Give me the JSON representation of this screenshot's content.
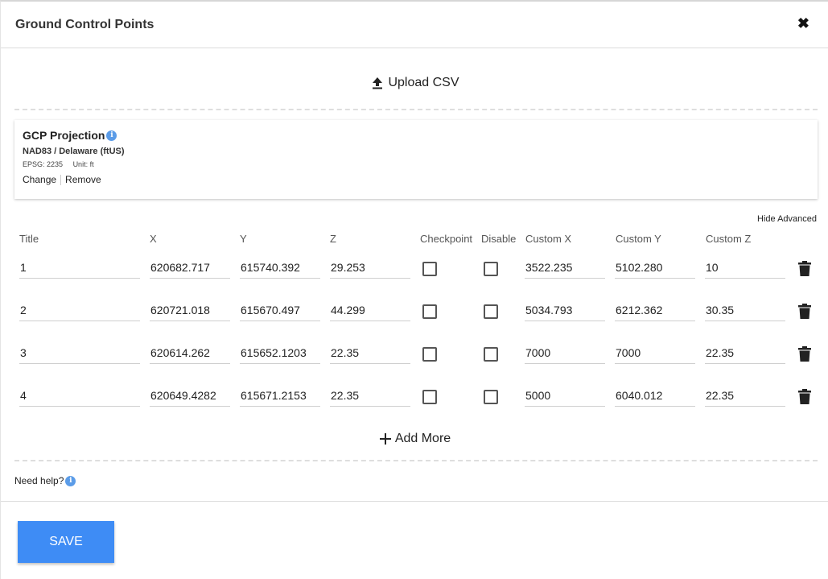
{
  "dialog": {
    "title": "Ground Control Points",
    "close_label": "✖"
  },
  "upload": {
    "label": "Upload CSV"
  },
  "projection": {
    "heading": "GCP Projection",
    "name": "NAD83 / Delaware (ftUS)",
    "epsg": "EPSG: 2235",
    "unit": "Unit: ft",
    "change_label": "Change",
    "remove_label": "Remove"
  },
  "table": {
    "toggle_label": "Hide Advanced",
    "headers": {
      "title": "Title",
      "x": "X",
      "y": "Y",
      "z": "Z",
      "checkpoint": "Checkpoint",
      "disable": "Disable",
      "custom_x": "Custom X",
      "custom_y": "Custom Y",
      "custom_z": "Custom Z"
    },
    "rows": [
      {
        "title": "1",
        "x": "620682.717",
        "y": "615740.392",
        "z": "29.253",
        "checkpoint": false,
        "disable": false,
        "custom_x": "3522.235",
        "custom_y": "5102.280",
        "custom_z": "10"
      },
      {
        "title": "2",
        "x": "620721.018",
        "y": "615670.497",
        "z": "44.299",
        "checkpoint": false,
        "disable": false,
        "custom_x": "5034.793",
        "custom_y": "6212.362",
        "custom_z": "30.35"
      },
      {
        "title": "3",
        "x": "620614.262",
        "y": "615652.1203",
        "z": "22.35",
        "checkpoint": false,
        "disable": false,
        "custom_x": "7000",
        "custom_y": "7000",
        "custom_z": "22.35"
      },
      {
        "title": "4",
        "x": "620649.4282",
        "y": "615671.2153",
        "z": "22.35",
        "checkpoint": false,
        "disable": false,
        "custom_x": "5000",
        "custom_y": "6040.012",
        "custom_z": "22.35"
      }
    ],
    "add_more_label": "Add More"
  },
  "help": {
    "label": "Need help?"
  },
  "footer": {
    "save_label": "SAVE"
  },
  "colors": {
    "accent": "#3e8cf5",
    "info": "#5b9ce8"
  }
}
